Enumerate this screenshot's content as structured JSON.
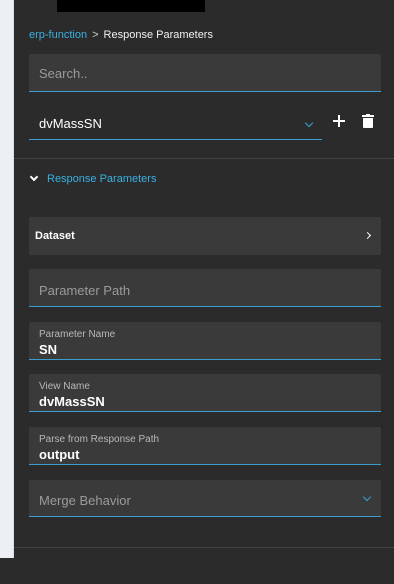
{
  "breadcrumb": {
    "parent": "erp-function",
    "separator": ">",
    "current": "Response Parameters"
  },
  "search": {
    "placeholder": "Search.."
  },
  "view_selector": {
    "selected": "dvMassSN",
    "add_icon": "plus-icon",
    "delete_icon": "trash-icon"
  },
  "section": {
    "title": "Response Parameters",
    "expanded": true
  },
  "dataset": {
    "label": "Dataset"
  },
  "fields": {
    "parameter_path": {
      "placeholder": "Parameter Path"
    },
    "parameter_name": {
      "label": "Parameter Name",
      "value": "SN"
    },
    "view_name": {
      "label": "View Name",
      "value": "dvMassSN"
    },
    "parse_path": {
      "label": "Parse from Response Path",
      "value": "output"
    },
    "merge_behavior": {
      "placeholder": "Merge Behavior"
    }
  },
  "colors": {
    "background": "#2b2b2b",
    "field_bg": "#3a3a3a",
    "accent": "#3ab0e2"
  }
}
